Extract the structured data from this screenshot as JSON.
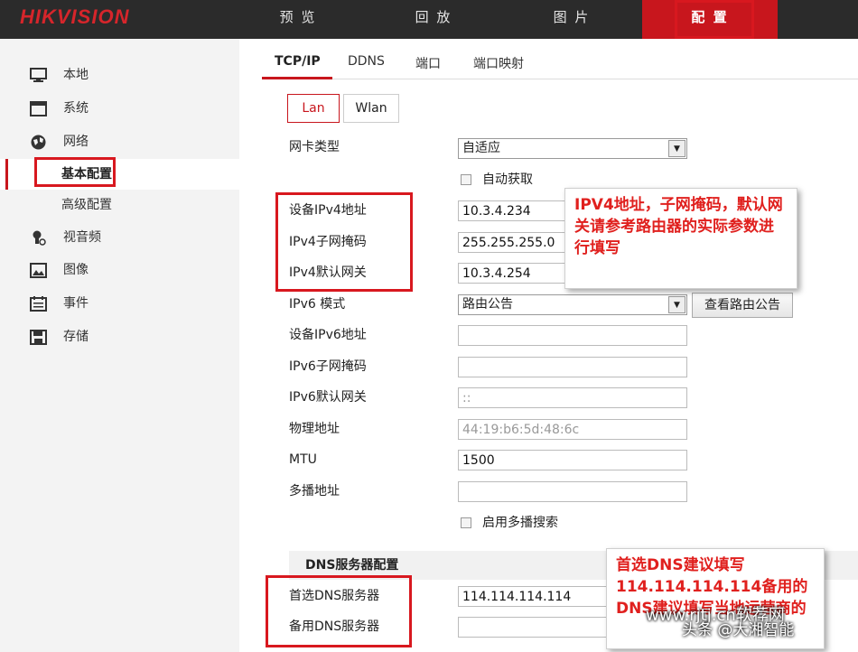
{
  "header": {
    "logo": "HIKVISION",
    "nav": [
      "预 览",
      "回 放",
      "图 片",
      "配 置"
    ]
  },
  "sidebar": {
    "items": [
      {
        "label": "本地",
        "icon": "monitor-icon"
      },
      {
        "label": "系统",
        "icon": "window-icon"
      },
      {
        "label": "网络",
        "icon": "globe-icon"
      },
      {
        "label": "视音频",
        "icon": "microphone-icon"
      },
      {
        "label": "图像",
        "icon": "image-icon"
      },
      {
        "label": "事件",
        "icon": "calendar-icon"
      },
      {
        "label": "存储",
        "icon": "floppy-icon"
      }
    ],
    "sub": [
      "基本配置",
      "高级配置"
    ]
  },
  "tabs": [
    "TCP/IP",
    "DDNS",
    "端口",
    "端口映射"
  ],
  "subtabs": [
    "Lan",
    "Wlan"
  ],
  "form": {
    "nic_type": {
      "label": "网卡类型",
      "value": "自适应"
    },
    "auto_obtain": "自动获取",
    "ipv4_addr": {
      "label": "设备IPv4地址",
      "value": "10.3.4.234"
    },
    "ipv4_mask": {
      "label": "IPv4子网掩码",
      "value": "255.255.255.0"
    },
    "ipv4_gw": {
      "label": "IPv4默认网关",
      "value": "10.3.4.254"
    },
    "ipv6_mode": {
      "label": "IPv6 模式",
      "value": "路由公告"
    },
    "view_route_btn": "查看路由公告",
    "ipv6_addr": {
      "label": "设备IPv6地址",
      "value": ""
    },
    "ipv6_mask": {
      "label": "IPv6子网掩码",
      "value": ""
    },
    "ipv6_gw": {
      "label": "IPv6默认网关",
      "value": "::"
    },
    "mac": {
      "label": "物理地址",
      "value": "44:19:b6:5d:48:6c"
    },
    "mtu": {
      "label": "MTU",
      "value": "1500"
    },
    "multicast": {
      "label": "多播地址",
      "value": ""
    },
    "enable_multicast": "启用多播搜索",
    "dns_header": "DNS服务器配置",
    "dns1": {
      "label": "首选DNS服务器",
      "value": "114.114.114.114"
    },
    "dns2": {
      "label": "备用DNS服务器",
      "value": ""
    }
  },
  "callouts": {
    "ipv4_note": "IPV4地址，子网掩码，默认网关请参考路由器的实际参数进行填写",
    "dns_note": "首选DNS建议填写114.114.114.114备用的DNS建议填写当地运营商的"
  },
  "watermark": {
    "site": "www.rjtj.cn软荐网",
    "author": "头条 @大湘智能"
  },
  "colors": {
    "brand_red": "#c8161d",
    "topbar": "#2b2b2b",
    "sidebar": "#f3f3f3"
  }
}
